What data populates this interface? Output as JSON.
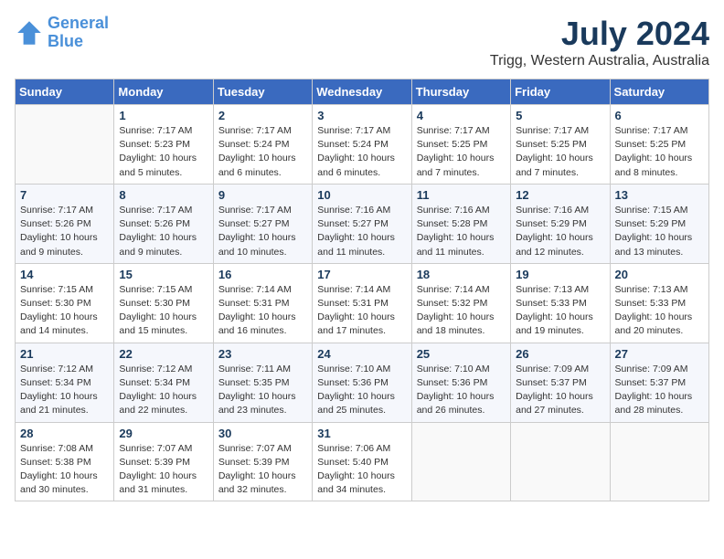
{
  "logo": {
    "line1": "General",
    "line2": "Blue"
  },
  "title": "July 2024",
  "subtitle": "Trigg, Western Australia, Australia",
  "days_of_week": [
    "Sunday",
    "Monday",
    "Tuesday",
    "Wednesday",
    "Thursday",
    "Friday",
    "Saturday"
  ],
  "weeks": [
    [
      {
        "day": "",
        "content": ""
      },
      {
        "day": "1",
        "content": "Sunrise: 7:17 AM\nSunset: 5:23 PM\nDaylight: 10 hours\nand 5 minutes."
      },
      {
        "day": "2",
        "content": "Sunrise: 7:17 AM\nSunset: 5:24 PM\nDaylight: 10 hours\nand 6 minutes."
      },
      {
        "day": "3",
        "content": "Sunrise: 7:17 AM\nSunset: 5:24 PM\nDaylight: 10 hours\nand 6 minutes."
      },
      {
        "day": "4",
        "content": "Sunrise: 7:17 AM\nSunset: 5:25 PM\nDaylight: 10 hours\nand 7 minutes."
      },
      {
        "day": "5",
        "content": "Sunrise: 7:17 AM\nSunset: 5:25 PM\nDaylight: 10 hours\nand 7 minutes."
      },
      {
        "day": "6",
        "content": "Sunrise: 7:17 AM\nSunset: 5:25 PM\nDaylight: 10 hours\nand 8 minutes."
      }
    ],
    [
      {
        "day": "7",
        "content": "Sunrise: 7:17 AM\nSunset: 5:26 PM\nDaylight: 10 hours\nand 9 minutes."
      },
      {
        "day": "8",
        "content": "Sunrise: 7:17 AM\nSunset: 5:26 PM\nDaylight: 10 hours\nand 9 minutes."
      },
      {
        "day": "9",
        "content": "Sunrise: 7:17 AM\nSunset: 5:27 PM\nDaylight: 10 hours\nand 10 minutes."
      },
      {
        "day": "10",
        "content": "Sunrise: 7:16 AM\nSunset: 5:27 PM\nDaylight: 10 hours\nand 11 minutes."
      },
      {
        "day": "11",
        "content": "Sunrise: 7:16 AM\nSunset: 5:28 PM\nDaylight: 10 hours\nand 11 minutes."
      },
      {
        "day": "12",
        "content": "Sunrise: 7:16 AM\nSunset: 5:29 PM\nDaylight: 10 hours\nand 12 minutes."
      },
      {
        "day": "13",
        "content": "Sunrise: 7:15 AM\nSunset: 5:29 PM\nDaylight: 10 hours\nand 13 minutes."
      }
    ],
    [
      {
        "day": "14",
        "content": "Sunrise: 7:15 AM\nSunset: 5:30 PM\nDaylight: 10 hours\nand 14 minutes."
      },
      {
        "day": "15",
        "content": "Sunrise: 7:15 AM\nSunset: 5:30 PM\nDaylight: 10 hours\nand 15 minutes."
      },
      {
        "day": "16",
        "content": "Sunrise: 7:14 AM\nSunset: 5:31 PM\nDaylight: 10 hours\nand 16 minutes."
      },
      {
        "day": "17",
        "content": "Sunrise: 7:14 AM\nSunset: 5:31 PM\nDaylight: 10 hours\nand 17 minutes."
      },
      {
        "day": "18",
        "content": "Sunrise: 7:14 AM\nSunset: 5:32 PM\nDaylight: 10 hours\nand 18 minutes."
      },
      {
        "day": "19",
        "content": "Sunrise: 7:13 AM\nSunset: 5:33 PM\nDaylight: 10 hours\nand 19 minutes."
      },
      {
        "day": "20",
        "content": "Sunrise: 7:13 AM\nSunset: 5:33 PM\nDaylight: 10 hours\nand 20 minutes."
      }
    ],
    [
      {
        "day": "21",
        "content": "Sunrise: 7:12 AM\nSunset: 5:34 PM\nDaylight: 10 hours\nand 21 minutes."
      },
      {
        "day": "22",
        "content": "Sunrise: 7:12 AM\nSunset: 5:34 PM\nDaylight: 10 hours\nand 22 minutes."
      },
      {
        "day": "23",
        "content": "Sunrise: 7:11 AM\nSunset: 5:35 PM\nDaylight: 10 hours\nand 23 minutes."
      },
      {
        "day": "24",
        "content": "Sunrise: 7:10 AM\nSunset: 5:36 PM\nDaylight: 10 hours\nand 25 minutes."
      },
      {
        "day": "25",
        "content": "Sunrise: 7:10 AM\nSunset: 5:36 PM\nDaylight: 10 hours\nand 26 minutes."
      },
      {
        "day": "26",
        "content": "Sunrise: 7:09 AM\nSunset: 5:37 PM\nDaylight: 10 hours\nand 27 minutes."
      },
      {
        "day": "27",
        "content": "Sunrise: 7:09 AM\nSunset: 5:37 PM\nDaylight: 10 hours\nand 28 minutes."
      }
    ],
    [
      {
        "day": "28",
        "content": "Sunrise: 7:08 AM\nSunset: 5:38 PM\nDaylight: 10 hours\nand 30 minutes."
      },
      {
        "day": "29",
        "content": "Sunrise: 7:07 AM\nSunset: 5:39 PM\nDaylight: 10 hours\nand 31 minutes."
      },
      {
        "day": "30",
        "content": "Sunrise: 7:07 AM\nSunset: 5:39 PM\nDaylight: 10 hours\nand 32 minutes."
      },
      {
        "day": "31",
        "content": "Sunrise: 7:06 AM\nSunset: 5:40 PM\nDaylight: 10 hours\nand 34 minutes."
      },
      {
        "day": "",
        "content": ""
      },
      {
        "day": "",
        "content": ""
      },
      {
        "day": "",
        "content": ""
      }
    ]
  ]
}
